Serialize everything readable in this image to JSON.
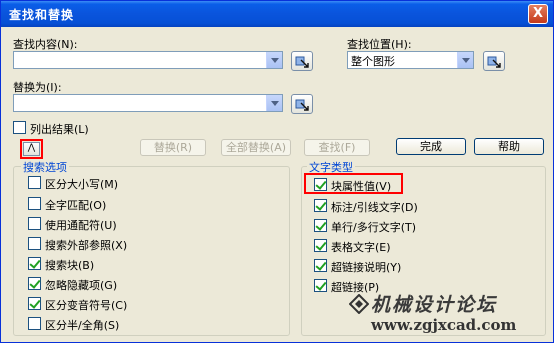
{
  "dialog": {
    "title": "查找和替换",
    "close_glyph": "X"
  },
  "find": {
    "label": "查找内容(N):",
    "value": ""
  },
  "location": {
    "label": "查找位置(H):",
    "value": "整个图形"
  },
  "replace": {
    "label": "替换为(I):",
    "value": ""
  },
  "list_results": {
    "label": "列出结果(L)",
    "checked": false
  },
  "toggle": {
    "glyph": "⋀"
  },
  "buttons": {
    "replace": "替换(R)",
    "replace_all": "全部替换(A)",
    "find": "查找(F)",
    "done": "完成",
    "help": "帮助"
  },
  "search_options": {
    "title": "搜索选项",
    "items": [
      {
        "label": "区分大小写(M)",
        "checked": false
      },
      {
        "label": "全字匹配(O)",
        "checked": false
      },
      {
        "label": "使用通配符(U)",
        "checked": false
      },
      {
        "label": "搜索外部参照(X)",
        "checked": false
      },
      {
        "label": "搜索块(B)",
        "checked": true
      },
      {
        "label": "忽略隐藏项(G)",
        "checked": true
      },
      {
        "label": "区分变音符号(C)",
        "checked": true
      },
      {
        "label": "区分半/全角(S)",
        "checked": false
      }
    ]
  },
  "text_types": {
    "title": "文字类型",
    "items": [
      {
        "label": "块属性值(V)",
        "checked": true
      },
      {
        "label": "标注/引线文字(D)",
        "checked": true
      },
      {
        "label": "单行/多行文字(T)",
        "checked": true
      },
      {
        "label": "表格文字(E)",
        "checked": true
      },
      {
        "label": "超链接说明(Y)",
        "checked": true
      },
      {
        "label": "超链接(P)",
        "checked": true
      }
    ]
  },
  "watermark": {
    "line1": "机械设计论坛",
    "line2": "www.zgjxcad.com"
  },
  "colors": {
    "title_bar": "#0a54dc",
    "highlight": "#ff0000",
    "group_title": "#0046d5",
    "dialog_bg": "#ece9d8"
  }
}
